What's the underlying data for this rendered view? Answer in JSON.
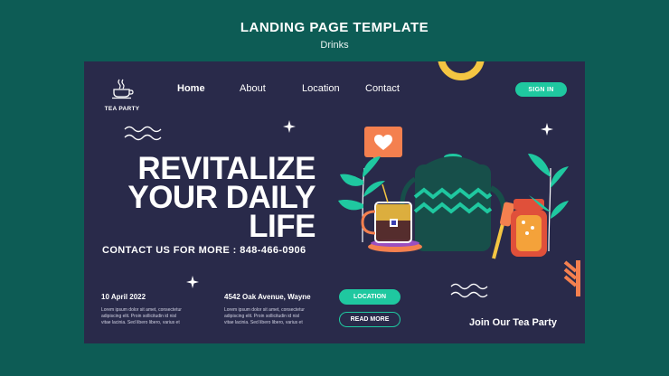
{
  "page_header": {
    "title": "LANDING PAGE TEMPLATE",
    "subtitle": "Drinks"
  },
  "logo": {
    "label": "TEA PARTY"
  },
  "nav": {
    "home": "Home",
    "about": "About",
    "location": "Location",
    "contact": "Contact"
  },
  "sign_in": "SIGN IN",
  "hero": {
    "line1": "REVITALIZE",
    "line2": "YOUR DAILY",
    "line3": "LIFE"
  },
  "contact": "CONTACT US FOR MORE : 848-466-0906",
  "info": {
    "date": "10 April 2022",
    "address": "4542 Oak Avenue, Wayne",
    "lorem": "Lorem ipsum dolor sit amet, consectetur adipiscing elit. Proin sollicitudin id nisl vitae lacinia. Sed libero libero, varius et"
  },
  "buttons": {
    "location": "LOCATION",
    "read_more": "READ MORE"
  },
  "join": "Join Our Tea Party",
  "colors": {
    "background": "#0d5c55",
    "card": "#292a4a",
    "accent": "#1fc8a0",
    "orange": "#f4804f",
    "yellow": "#f4c542"
  }
}
